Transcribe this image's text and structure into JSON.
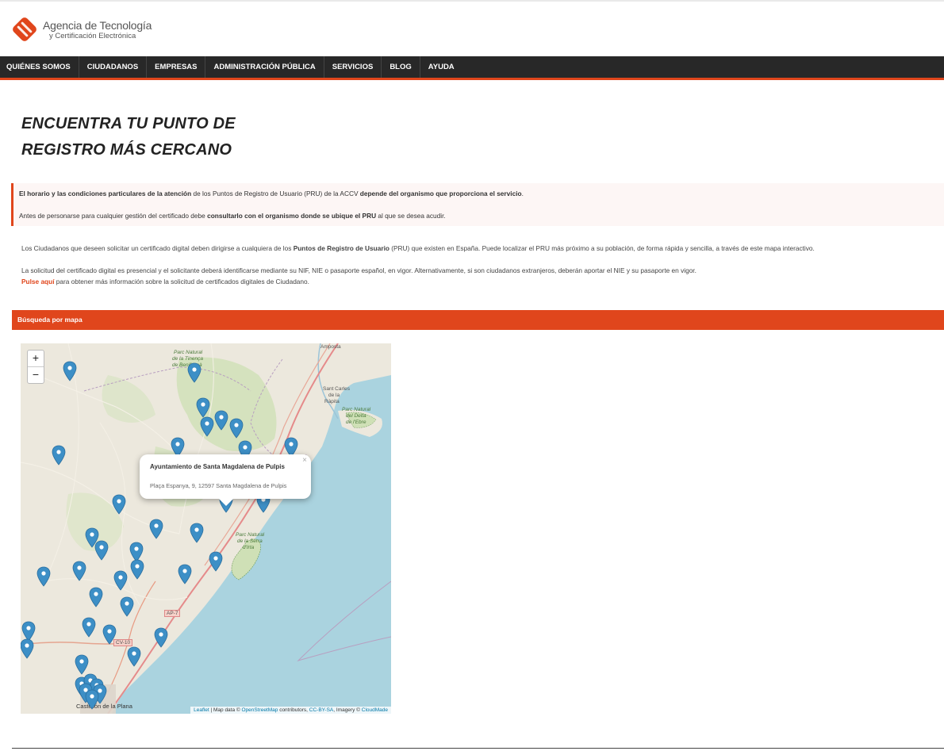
{
  "header": {
    "logo_line1": "Agencia de Tecnología",
    "logo_line2": "y Certificación Electrónica"
  },
  "nav": [
    "QUIÉNES SOMOS",
    "CIUDADANOS",
    "EMPRESAS",
    "ADMINISTRACIÓN PÚBLICA",
    "SERVICIOS",
    "BLOG",
    "AYUDA"
  ],
  "page": {
    "title_line1": "ENCUENTRA TU PUNTO DE",
    "title_line2": "REGISTRO MÁS CERCANO"
  },
  "notice": {
    "p1_bold1": "El horario y las condiciones particulares de la atención",
    "p1_text1": " de los Puntos de Registro de Usuario (PRU) de la ACCV ",
    "p1_bold2": "depende del organismo que proporciona el servicio",
    "p1_text2": ".",
    "p2_text1": "Antes de personarse para cualquier gestión del certificado debe ",
    "p2_bold1": "consultarlo con el organismo donde se ubique el PRU",
    "p2_text2": " al que se desea acudir."
  },
  "info": {
    "p1_text1": "Los Ciudadanos que deseen solicitar un certificado digital deben dirigirse a cualquiera de los ",
    "p1_bold": "Puntos de Registro de Usuario",
    "p1_text2": " (PRU) que existen en España. Puede localizar el PRU más próximo a su población, de forma rápida y sencilla, a través de este mapa interactivo.",
    "p2_text": "La solicitud del certificado digital es presencial y el solicitante deberá identificarse mediante su NIF, NIE o pasaporte español, en vigor. Alternativamente, si son ciudadanos extranjeros, deberán aportar el NIE y su pasaporte en vigor.",
    "p3_link": "Pulse aquí",
    "p3_text": " para obtener más información sobre la solicitud de certificados digitales de Ciudadano."
  },
  "section": {
    "title": "Búsqueda por mapa"
  },
  "map": {
    "zoom_in": "+",
    "zoom_out": "−",
    "popup_title": "Ayuntamiento de Santa Magdalena de Pulpis",
    "popup_address": "Plaça Espanya, 9, 12597 Santa Magdalena de Pulpis",
    "popup_close": "×",
    "labels": {
      "amposta": "Amposta",
      "sant_carles_1": "Sant Carles",
      "sant_carles_2": "de la",
      "sant_carles_3": "Ràpita",
      "park1_1": "Parc Natural",
      "park1_2": "de la Tinença",
      "park1_3": "de Benifassà",
      "park2_1": "Parc Natural",
      "park2_2": "del Delta",
      "park2_3": "de l'Ebre",
      "park3_1": "Parc Natural",
      "park3_2": "de la Serra",
      "park3_3": "d'Irta",
      "ap7": "AP-7",
      "cv10": "CV-10",
      "castellon": "Castellón de la Plana"
    },
    "attribution_leaflet": "Leaflet",
    "attribution_text1": " | Map data © ",
    "attribution_osm": "OpenStreetMap",
    "attribution_text2": " contributors, ",
    "attribution_cc": "CC-BY-SA",
    "attribution_text3": ", Imagery © ",
    "attribution_cm": "CloudMade",
    "marker_color": "#3d8fc6"
  },
  "colors": {
    "accent": "#e0461c",
    "nav_bg": "#282828",
    "water": "#aad3df"
  }
}
